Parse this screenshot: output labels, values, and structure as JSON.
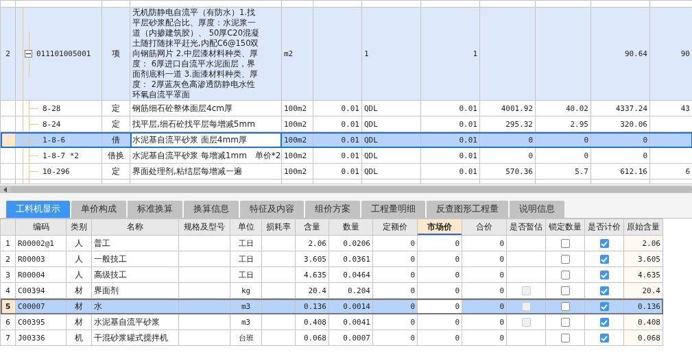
{
  "top_grid": {
    "rows": [
      {
        "no": "2",
        "code": "011101005001",
        "kind": "bill",
        "expanded": true,
        "type": "项",
        "name": "无机防静电自流平（有防水）1.找平层砂浆配合比、厚度：水泥浆一道（内掺建筑胶）、 50厚C20混凝土随打随抹平赶光,内配C6@150双向钢筋网片 2.中层漆材料种类、厚度： 6厚进口自流平水泥面层，界面剂底料一道 3.面漆材料种类、厚度： 2厚蓝灰色高渗透防静电水性环氧自流平罩面",
        "unit": "m2",
        "column_7": "1",
        "column_8": "1",
        "column_11": "90.64",
        "column_12": "90",
        "selected": false
      },
      {
        "code": "8-28",
        "kind": "quota",
        "type": "定",
        "name": "钢筋细石砼整体面层4cm厚",
        "unit": "100m2",
        "column_6": "0.01",
        "column_7": "QDL",
        "column_8": "0.01",
        "column_9": "4001.92",
        "column_10": "40.02",
        "column_11": "4337.24",
        "column_12": "43",
        "selected": false
      },
      {
        "code": "8-24",
        "kind": "quota",
        "type": "定",
        "name": "找平层,细石砼找平层每增减5mm",
        "unit": "100m2",
        "column_6": "0.01",
        "column_7": "QDL",
        "column_8": "0.01",
        "column_9": "295.32",
        "column_10": "2.95",
        "column_11": "320.06",
        "selected": false
      },
      {
        "code": "1-8-6",
        "kind": "quota",
        "type": "借",
        "name": "水泥基自流平砂浆 面层4mm厚",
        "unit": "100m2",
        "column_6": "0.01",
        "column_7": "QDL",
        "column_8": "0.01",
        "column_9": "0",
        "column_10": "0",
        "column_11": "0",
        "selected": true
      },
      {
        "code": "1-8-7 *2",
        "kind": "quota",
        "type": "借换",
        "name": "水泥基自流平砂浆 每增减1mm　单价*2",
        "unit": "100m2",
        "column_6": "0.01",
        "column_7": "QDL",
        "column_8": "0.01",
        "column_9": "0",
        "column_10": "0",
        "column_11": "0",
        "selected": false
      },
      {
        "code": "10-296",
        "kind": "quota",
        "type": "定",
        "name": "界面处理剂,粘结层每增减一遍",
        "unit": "100m2",
        "column_6": "0.01",
        "column_7": "QDL",
        "column_8": "0.01",
        "column_9": "570.36",
        "column_10": "5.7",
        "column_11": "612.16",
        "column_12": "6",
        "selected": false
      }
    ]
  },
  "tabs": [
    {
      "label": "工料机显示",
      "selected": true
    },
    {
      "label": "单价构成",
      "selected": false
    },
    {
      "label": "标准换算",
      "selected": false
    },
    {
      "label": "换算信息",
      "selected": false
    },
    {
      "label": "特征及内容",
      "selected": false
    },
    {
      "label": "组价方案",
      "selected": false
    },
    {
      "label": "工程量明细",
      "selected": false
    },
    {
      "label": "反查图形工程量",
      "selected": false
    },
    {
      "label": "说明信息",
      "selected": false
    }
  ],
  "resource_table": {
    "columns": [
      {
        "label": "编码",
        "selected": false
      },
      {
        "label": "类别",
        "selected": false
      },
      {
        "label": "名称",
        "selected": false
      },
      {
        "label": "规格及型号",
        "selected": false
      },
      {
        "label": "单位",
        "selected": false
      },
      {
        "label": "损耗率",
        "selected": false
      },
      {
        "label": "含量",
        "selected": false
      },
      {
        "label": "数量",
        "selected": false
      },
      {
        "label": "定额价",
        "selected": false
      },
      {
        "label": "市场价",
        "selected": true
      },
      {
        "label": "合价",
        "selected": false
      },
      {
        "label": "是否暂估",
        "selected": false
      },
      {
        "label": "锁定数量",
        "selected": false
      },
      {
        "label": "是否计价",
        "selected": false
      },
      {
        "label": "原始含量",
        "selected": false
      }
    ],
    "rows": [
      {
        "no": "1",
        "code": "R00002@1",
        "category": "人",
        "name": "普工",
        "unit": "工日",
        "content": "2.06",
        "quantity": "0.0206",
        "quota_price": "0",
        "market_price": "0",
        "total": "0",
        "provisional_box": false,
        "locked": false,
        "priced": true,
        "original": "2.06",
        "selected": false
      },
      {
        "no": "2",
        "code": "R00003",
        "category": "人",
        "name": "一般技工",
        "unit": "工日",
        "content": "3.605",
        "quantity": "0.0361",
        "quota_price": "0",
        "market_price": "0",
        "total": "0",
        "provisional_box": false,
        "locked": false,
        "priced": true,
        "original": "3.605",
        "selected": false
      },
      {
        "no": "3",
        "code": "R00004",
        "category": "人",
        "name": "高级技工",
        "unit": "工日",
        "content": "4.635",
        "quantity": "0.0464",
        "quota_price": "0",
        "market_price": "0",
        "total": "0",
        "provisional_box": false,
        "locked": false,
        "priced": true,
        "original": "4.635",
        "selected": false
      },
      {
        "no": "4",
        "code": "C00394",
        "category": "材",
        "name": "界面剂",
        "unit": "kg",
        "content": "20.4",
        "quantity": "0.204",
        "quota_price": "0",
        "market_price": "0",
        "total": "0",
        "provisional_box": true,
        "locked": false,
        "priced": true,
        "original": "20.4",
        "selected": false
      },
      {
        "no": "5",
        "code": "C00007",
        "category": "材",
        "name": "水",
        "unit": "m3",
        "content": "0.136",
        "quantity": "0.0014",
        "quota_price": "0",
        "market_price": "0",
        "total": "0",
        "provisional_box": true,
        "locked": false,
        "priced": true,
        "original": "0.136",
        "selected": true
      },
      {
        "no": "6",
        "code": "C00395",
        "category": "材",
        "name": "水泥基自流平砂浆",
        "unit": "m3",
        "content": "0.408",
        "quantity": "0.0041",
        "quota_price": "0",
        "market_price": "0",
        "total": "0",
        "provisional_box": true,
        "locked": false,
        "priced": true,
        "original": "0.408",
        "selected": false
      },
      {
        "no": "7",
        "code": "J00336",
        "category": "机",
        "name": "干混砂浆罐式搅拌机",
        "unit": "台班",
        "content": "0.068",
        "quantity": "0.0007",
        "quota_price": "0",
        "market_price": "0",
        "total": "0",
        "provisional_box": false,
        "locked": false,
        "priced": true,
        "original": "0.068",
        "selected": false
      }
    ]
  }
}
